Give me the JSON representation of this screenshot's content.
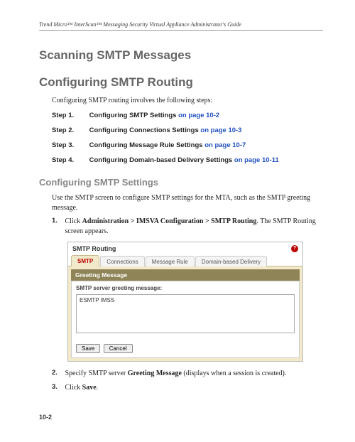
{
  "header": "Trend Micro™ InterScan™ Messaging Security Virtual Appliance Administrator's Guide",
  "h1a": "Scanning SMTP Messages",
  "h1b": "Configuring SMTP Routing",
  "intro": "Configuring SMTP routing involves the following steps:",
  "steps": [
    {
      "label": "Step 1.",
      "text": "Configuring SMTP Settings ",
      "link": "on page 10-2"
    },
    {
      "label": "Step 2.",
      "text": "Configuring Connections Settings ",
      "link": "on page 10-3"
    },
    {
      "label": "Step 3.",
      "text": "Configuring Message Rule Settings ",
      "link": "on page 10-7"
    },
    {
      "label": "Step 4.",
      "text": "Configuring Domain-based Delivery Settings ",
      "link": "on page 10-11"
    }
  ],
  "h2a": "Configuring SMTP Settings",
  "p1": "Use the SMTP screen to configure SMTP settings for the MTA, such as the SMTP greeting message.",
  "ol": [
    {
      "n": "1.",
      "pre": "Click ",
      "b": "Administration > IMSVA Configuration > SMTP Routing",
      "post": ". The SMTP Routing screen appears."
    },
    {
      "n": "2.",
      "pre": "Specify SMTP server ",
      "b": "Greeting Message",
      "post": " (displays when a session is created)."
    },
    {
      "n": "3.",
      "pre": "Click ",
      "b": "Save",
      "post": "."
    }
  ],
  "panel": {
    "title": "SMTP Routing",
    "tabs": [
      "SMTP",
      "Connections",
      "Message Rule",
      "Domain-based Delivery"
    ],
    "section_head": "Greeting Message",
    "field_label": "SMTP server greeting message:",
    "value": "ESMTP IMSS",
    "save": "Save",
    "cancel": "Cancel"
  },
  "page_num": "10-2"
}
